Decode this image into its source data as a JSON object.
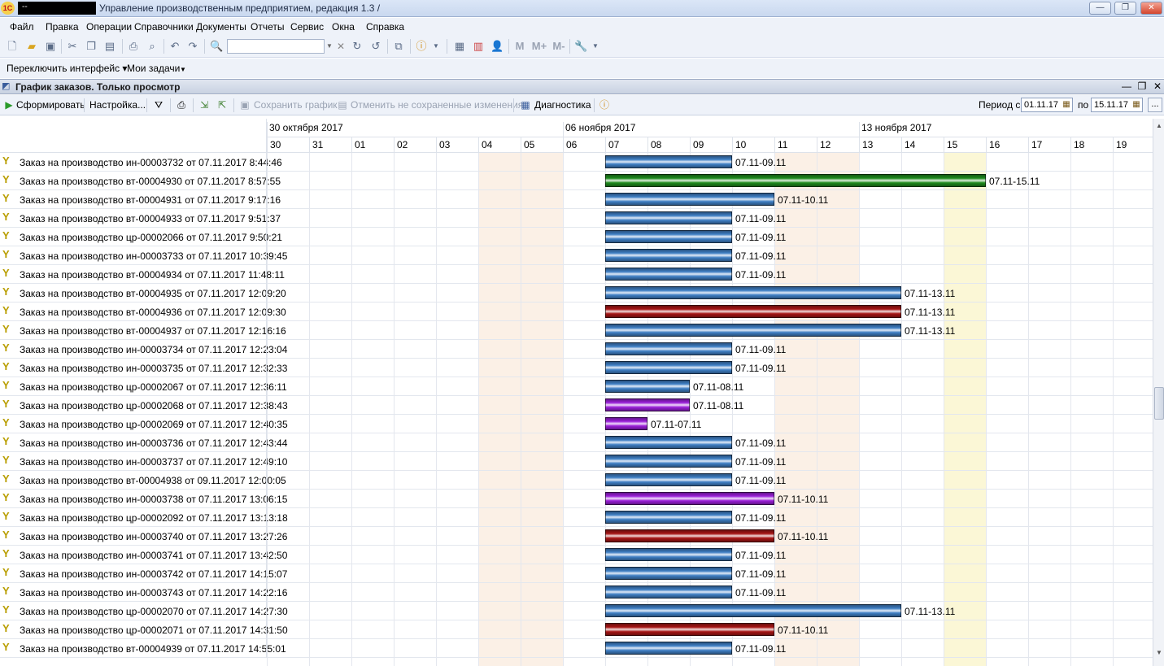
{
  "window": {
    "user": "--",
    "title": "Управление производственным предприятием, редакция 1.3 /",
    "min": "—",
    "max": "❐",
    "close": "✕"
  },
  "menu": [
    "Файл",
    "Правка",
    "Операции",
    "Справочники",
    "Документы",
    "Отчеты",
    "Сервис",
    "Окна",
    "Справка"
  ],
  "interface_bar": {
    "switch_interface": "Переключить интерфейс ▾",
    "my_tasks": "Мои задачи"
  },
  "document": {
    "title": "График заказов. Только просмотр"
  },
  "commands": {
    "form": "Сформировать",
    "settings": "Настройка...",
    "save_chart": "Сохранить график",
    "cancel_unsaved": "Отменить не сохраненные изменения",
    "diagnostics": "Диагностика",
    "period_from_label": "Период с",
    "period_from": "01.11.17",
    "period_to_label": "по",
    "period_to": "15.11.17",
    "more": "..."
  },
  "timeline": {
    "weeks": [
      "30 октября 2017",
      "06 ноября 2017",
      "13 ноября 2017"
    ],
    "days": [
      "30",
      "31",
      "01",
      "02",
      "03",
      "04",
      "05",
      "06",
      "07",
      "08",
      "09",
      "10",
      "11",
      "12",
      "13",
      "14",
      "15",
      "16",
      "17",
      "18",
      "19"
    ],
    "weekend_days": [
      "04",
      "05",
      "11",
      "12"
    ],
    "highlight_day": "15"
  },
  "colors": {
    "blue": "#3f7fc4",
    "green": "#1e8a1e",
    "red": "#a51515",
    "purple": "#9a1fd8"
  },
  "orders": [
    {
      "name": "Заказ на производство ин-00003732 от 07.11.2017 8:44:46",
      "start": "07",
      "end": "09",
      "label": "07.11-09.11",
      "color": "blue"
    },
    {
      "name": "Заказ на производство вт-00004930 от 07.11.2017 8:57:55",
      "start": "07",
      "end": "15",
      "label": "07.11-15.11",
      "color": "green"
    },
    {
      "name": "Заказ на производство вт-00004931 от 07.11.2017 9:17:16",
      "start": "07",
      "end": "10",
      "label": "07.11-10.11",
      "color": "blue"
    },
    {
      "name": "Заказ на производство вт-00004933 от 07.11.2017 9:51:37",
      "start": "07",
      "end": "09",
      "label": "07.11-09.11",
      "color": "blue"
    },
    {
      "name": "Заказ на производство цр-00002066 от 07.11.2017 9:50:21",
      "start": "07",
      "end": "09",
      "label": "07.11-09.11",
      "color": "blue"
    },
    {
      "name": "Заказ на производство ин-00003733 от 07.11.2017 10:39:45",
      "start": "07",
      "end": "09",
      "label": "07.11-09.11",
      "color": "blue"
    },
    {
      "name": "Заказ на производство вт-00004934 от 07.11.2017 11:48:11",
      "start": "07",
      "end": "09",
      "label": "07.11-09.11",
      "color": "blue"
    },
    {
      "name": "Заказ на производство вт-00004935 от 07.11.2017 12:09:20",
      "start": "07",
      "end": "13",
      "label": "07.11-13.11",
      "color": "blue"
    },
    {
      "name": "Заказ на производство вт-00004936 от 07.11.2017 12:09:30",
      "start": "07",
      "end": "13",
      "label": "07.11-13.11",
      "color": "red"
    },
    {
      "name": "Заказ на производство вт-00004937 от 07.11.2017 12:16:16",
      "start": "07",
      "end": "13",
      "label": "07.11-13.11",
      "color": "blue"
    },
    {
      "name": "Заказ на производство ин-00003734 от 07.11.2017 12:23:04",
      "start": "07",
      "end": "09",
      "label": "07.11-09.11",
      "color": "blue"
    },
    {
      "name": "Заказ на производство ин-00003735 от 07.11.2017 12:32:33",
      "start": "07",
      "end": "09",
      "label": "07.11-09.11",
      "color": "blue"
    },
    {
      "name": "Заказ на производство цр-00002067 от 07.11.2017 12:36:11",
      "start": "07",
      "end": "08",
      "label": "07.11-08.11",
      "color": "blue"
    },
    {
      "name": "Заказ на производство цр-00002068 от 07.11.2017 12:38:43",
      "start": "07",
      "end": "08",
      "label": "07.11-08.11",
      "color": "purple"
    },
    {
      "name": "Заказ на производство цр-00002069 от 07.11.2017 12:40:35",
      "start": "07",
      "end": "07",
      "label": "07.11-07.11",
      "color": "purple"
    },
    {
      "name": "Заказ на производство ин-00003736 от 07.11.2017 12:43:44",
      "start": "07",
      "end": "09",
      "label": "07.11-09.11",
      "color": "blue"
    },
    {
      "name": "Заказ на производство ин-00003737 от 07.11.2017 12:49:10",
      "start": "07",
      "end": "09",
      "label": "07.11-09.11",
      "color": "blue"
    },
    {
      "name": "Заказ на производство вт-00004938 от 09.11.2017 12:00:05",
      "start": "07",
      "end": "09",
      "label": "07.11-09.11",
      "color": "blue"
    },
    {
      "name": "Заказ на производство ин-00003738 от 07.11.2017 13:06:15",
      "start": "07",
      "end": "10",
      "label": "07.11-10.11",
      "color": "purple"
    },
    {
      "name": "Заказ на производство цр-00002092 от 07.11.2017 13:13:18",
      "start": "07",
      "end": "09",
      "label": "07.11-09.11",
      "color": "blue"
    },
    {
      "name": "Заказ на производство ин-00003740 от 07.11.2017 13:27:26",
      "start": "07",
      "end": "10",
      "label": "07.11-10.11",
      "color": "red"
    },
    {
      "name": "Заказ на производство ин-00003741 от 07.11.2017 13:42:50",
      "start": "07",
      "end": "09",
      "label": "07.11-09.11",
      "color": "blue"
    },
    {
      "name": "Заказ на производство ин-00003742 от 07.11.2017 14:15:07",
      "start": "07",
      "end": "09",
      "label": "07.11-09.11",
      "color": "blue"
    },
    {
      "name": "Заказ на производство ин-00003743 от 07.11.2017 14:22:16",
      "start": "07",
      "end": "09",
      "label": "07.11-09.11",
      "color": "blue"
    },
    {
      "name": "Заказ на производство цр-00002070 от 07.11.2017 14:27:30",
      "start": "07",
      "end": "13",
      "label": "07.11-13.11",
      "color": "blue"
    },
    {
      "name": "Заказ на производство цр-00002071 от 07.11.2017 14:31:50",
      "start": "07",
      "end": "10",
      "label": "07.11-10.11",
      "color": "red"
    },
    {
      "name": "Заказ на производство вт-00004939 от 07.11.2017 14:55:01",
      "start": "07",
      "end": "09",
      "label": "07.11-09.11",
      "color": "blue"
    }
  ]
}
